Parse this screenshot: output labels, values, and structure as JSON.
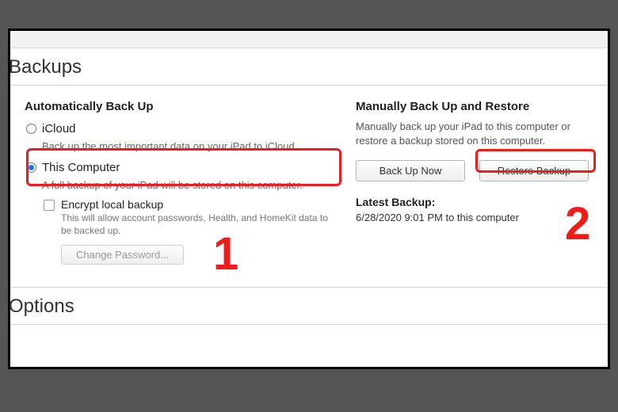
{
  "sections": {
    "backups": {
      "title": "Backups",
      "auto": {
        "heading": "Automatically Back Up",
        "icloud": {
          "label": "iCloud",
          "desc": "Back up the most important data on your iPad to iCloud."
        },
        "thisComputer": {
          "label": "This Computer",
          "desc": "A full backup of your iPad will be stored on this computer."
        },
        "encrypt": {
          "label": "Encrypt local backup",
          "desc": "This will allow account passwords, Health, and HomeKit data to be backed up."
        },
        "changePasswordLabel": "Change Password..."
      },
      "manual": {
        "heading": "Manually Back Up and Restore",
        "desc": "Manually back up your iPad to this computer or restore a backup stored on this computer.",
        "backupNowLabel": "Back Up Now",
        "restoreLabel": "Restore Backup"
      },
      "latest": {
        "label": "Latest Backup:",
        "value": "6/28/2020 9:01 PM to this computer"
      }
    },
    "options": {
      "title": "Options"
    }
  },
  "annotations": {
    "callout1": "1",
    "callout2": "2"
  }
}
